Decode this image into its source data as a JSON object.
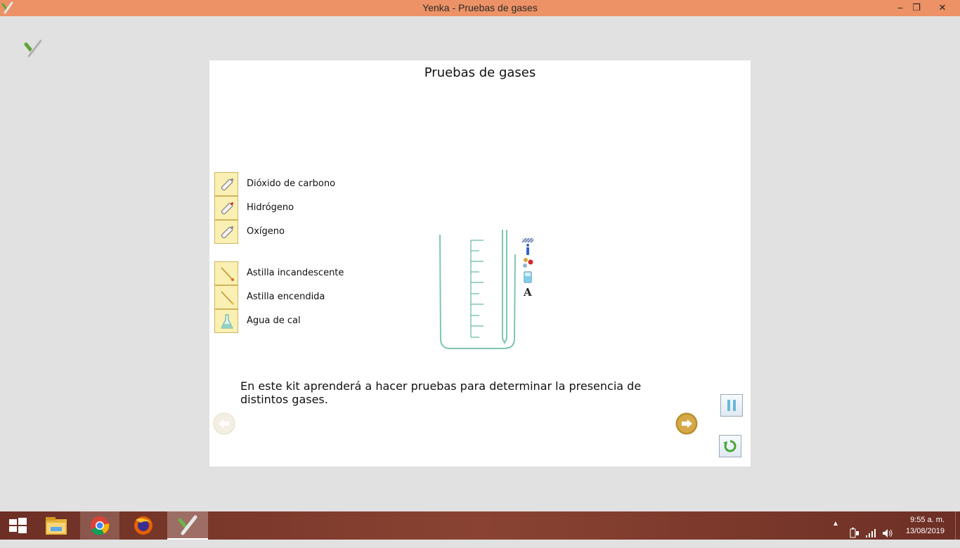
{
  "window": {
    "title": "Yenka - Pruebas de gases",
    "controls": {
      "minimize": "‒",
      "maximize": "❐",
      "close": "✕"
    }
  },
  "panel": {
    "title": "Pruebas de gases",
    "gases": [
      {
        "label": "Dióxido de carbono",
        "icon": "gas-cylinder-icon"
      },
      {
        "label": "Hidrógeno",
        "icon": "gas-cylinder-red-icon"
      },
      {
        "label": "Oxígeno",
        "icon": "gas-cylinder-icon"
      }
    ],
    "tests": [
      {
        "label": "Astilla incandescente",
        "icon": "glowing-splint-icon"
      },
      {
        "label": "Astilla encendida",
        "icon": "lit-splint-icon"
      },
      {
        "label": "Agua de cal",
        "icon": "flask-icon"
      }
    ],
    "side_tools": [
      "hatch-icon",
      "info-icon",
      "molecule-icon",
      "beaker-icon",
      "text-icon"
    ],
    "description": "En este kit aprenderá a hacer pruebas para determinar la presencia de distintos gases."
  },
  "taskbar": {
    "apps": [
      "start-icon",
      "file-explorer-icon",
      "chrome-icon",
      "firefox-icon",
      "yenka-icon"
    ],
    "tray_arrow": "▲",
    "time": "9:55 a. m.",
    "date": "13/08/2019"
  },
  "colors": {
    "titlebar": "#ec9266",
    "taskbar": "#7a3a2c",
    "panel": "#ffffff",
    "accent": "#cfb45e",
    "trough": "#7fc6b0"
  }
}
